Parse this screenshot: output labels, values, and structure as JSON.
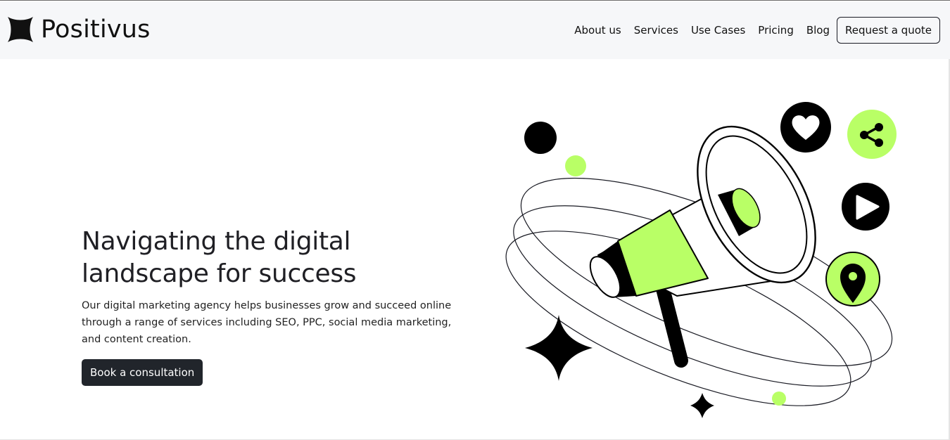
{
  "brand": {
    "name": "Positivus",
    "logo_icon": "four-point-star-logo-icon"
  },
  "nav": {
    "links": [
      "About us",
      "Services",
      "Use Cases",
      "Pricing",
      "Blog"
    ],
    "quote_button": "Request a quote"
  },
  "hero": {
    "title_line1": "Navigating the digital",
    "title_line2": "landscape for success",
    "description": "Our digital marketing agency helps businesses grow and succeed online through a range of services including SEO, PPC, social media marketing, and content creation.",
    "cta": "Book a consultation"
  },
  "illustration": {
    "subject": "megaphone-illustration",
    "icons": [
      "heart-icon",
      "share-icon",
      "play-icon",
      "location-pin-icon",
      "sparkle-star-icon"
    ]
  },
  "colors": {
    "accent": "#b9ff66",
    "dark": "#191a23",
    "nav_bg": "#f6f7f9",
    "cta_bg": "#21252b"
  }
}
